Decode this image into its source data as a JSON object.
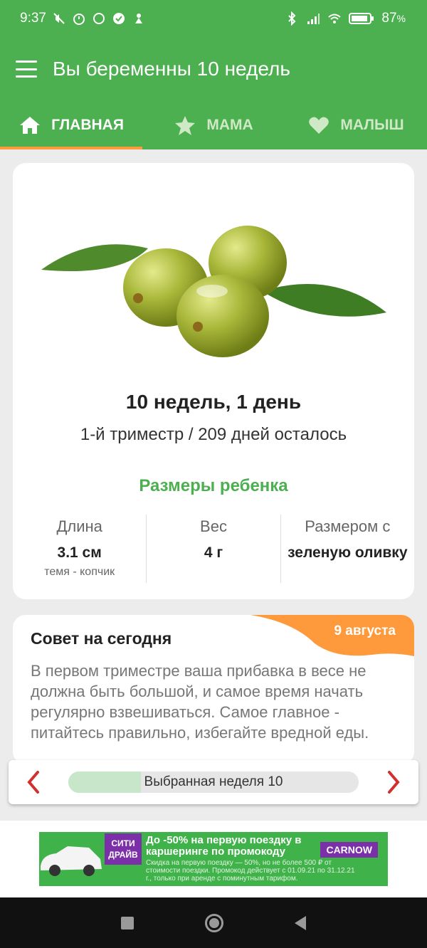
{
  "status": {
    "time": "9:37",
    "battery": "87",
    "battery_unit": "%"
  },
  "appbar": {
    "title": "Вы беременны 10 недель"
  },
  "tabs": [
    {
      "label": "ГЛАВНАЯ",
      "icon": "home-icon"
    },
    {
      "label": "МАМА",
      "icon": "star-icon"
    },
    {
      "label": "МАЛЫШ",
      "icon": "heart-icon"
    }
  ],
  "main": {
    "week_title": "10 недель, 1 день",
    "week_sub": "1-й триместр / 209 дней осталось",
    "sizes_title": "Размеры ребенка",
    "sizes": [
      {
        "label": "Длина",
        "value": "3.1 см",
        "note": "темя - копчик"
      },
      {
        "label": "Вес",
        "value": "4 г",
        "note": ""
      },
      {
        "label": "Размером с",
        "value": "зеленую оливку",
        "note": ""
      }
    ]
  },
  "tip": {
    "title": "Совет на сегодня",
    "date": "9 августа",
    "text": "В первом триместре ваша прибавка в весе не должна быть большой, и самое время начать регулярно взвешиваться. Самое главное - питайтесь правильно, избегайте вредной еды."
  },
  "week_nav": {
    "label": "Выбранная неделя 10",
    "progress": 0.25
  },
  "ad": {
    "logo": "СИТИ ДРАЙВ",
    "headline": "До -50% на первую поездку в каршеринге по промокоду",
    "brand": "CARNOW",
    "fine_print": "Скидка на первую поездку — 50%, но не более 500 ₽ от стоимости поездки. Промокод действует с 01.09.21 по 31.12.21 г., только при аренде с поминутным тарифом."
  },
  "colors": {
    "primary": "#4caf50",
    "accent": "#ff9a3c",
    "arrow": "#d32f2f"
  }
}
